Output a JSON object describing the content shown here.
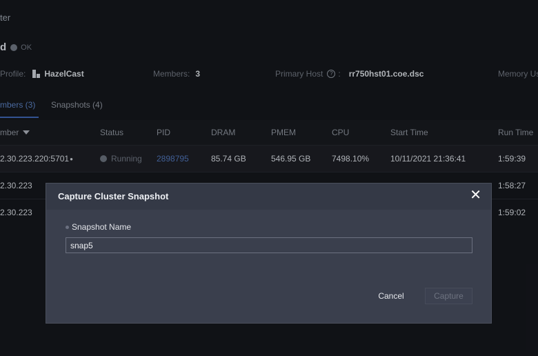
{
  "breadcrumb": "ter",
  "cluster": {
    "name": "d",
    "status": "OK"
  },
  "info": {
    "profile_label": "Profile:",
    "profile_value": "HazelCast",
    "members_label": "Members:",
    "members_value": "3",
    "primary_host_label": "Primary Host",
    "primary_host_colon": ":",
    "primary_host_value": "rr750hst01.coe.dsc",
    "memory_label": "Memory Us"
  },
  "tabs": [
    {
      "label": "mbers (3)",
      "active": true
    },
    {
      "label": "Snapshots (4)",
      "active": false
    }
  ],
  "table": {
    "headers": {
      "member": "mber",
      "status": "Status",
      "pid": "PID",
      "dram": "DRAM",
      "pmem": "PMEM",
      "cpu": "CPU",
      "start_time": "Start Time",
      "run_time": "Run Time"
    },
    "rows": [
      {
        "member": "2.30.223.220:5701",
        "master_mark": "●",
        "status": "Running",
        "pid": "2898795",
        "dram": "85.74 GB",
        "pmem": "546.95 GB",
        "cpu": "7498.10%",
        "start_time": "10/11/2021 21:36:41",
        "run_time": "1:59:39"
      },
      {
        "member": "2.30.223",
        "run_time": "1:58:27"
      },
      {
        "member": "2.30.223",
        "run_time": "1:59:02"
      }
    ]
  },
  "modal": {
    "title": "Capture Cluster Snapshot",
    "close": "✕",
    "field_label": "Snapshot Name",
    "field_value": "snap5",
    "cancel_label": "Cancel",
    "capture_label": "Capture"
  },
  "colors": {
    "background": "#131419",
    "modal_bg": "#3a3f4d",
    "link": "#4f72b5",
    "active_tab": "#3e63b0"
  }
}
